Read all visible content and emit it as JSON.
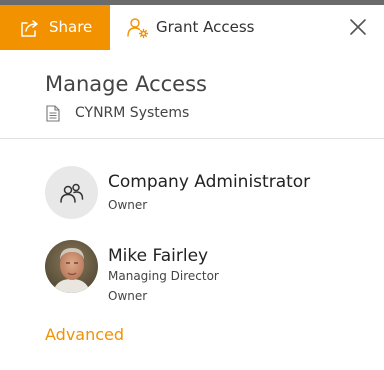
{
  "tabs": {
    "share_label": "Share",
    "grant_label": "Grant Access"
  },
  "panel": {
    "title": "Manage Access",
    "document_name": "CYNRM Systems"
  },
  "people": [
    {
      "name": "Company Administrator",
      "role": "Owner"
    },
    {
      "name": "Mike Fairley",
      "position": "Managing Director",
      "role": "Owner"
    }
  ],
  "advanced_link": "Advanced",
  "colors": {
    "accent": "#f39200",
    "tabbar_bg": "#f3f3f3",
    "divider": "#e1e1e1"
  },
  "icons": [
    "share-icon",
    "grant-access-icon",
    "close-icon",
    "document-icon",
    "group-icon"
  ]
}
